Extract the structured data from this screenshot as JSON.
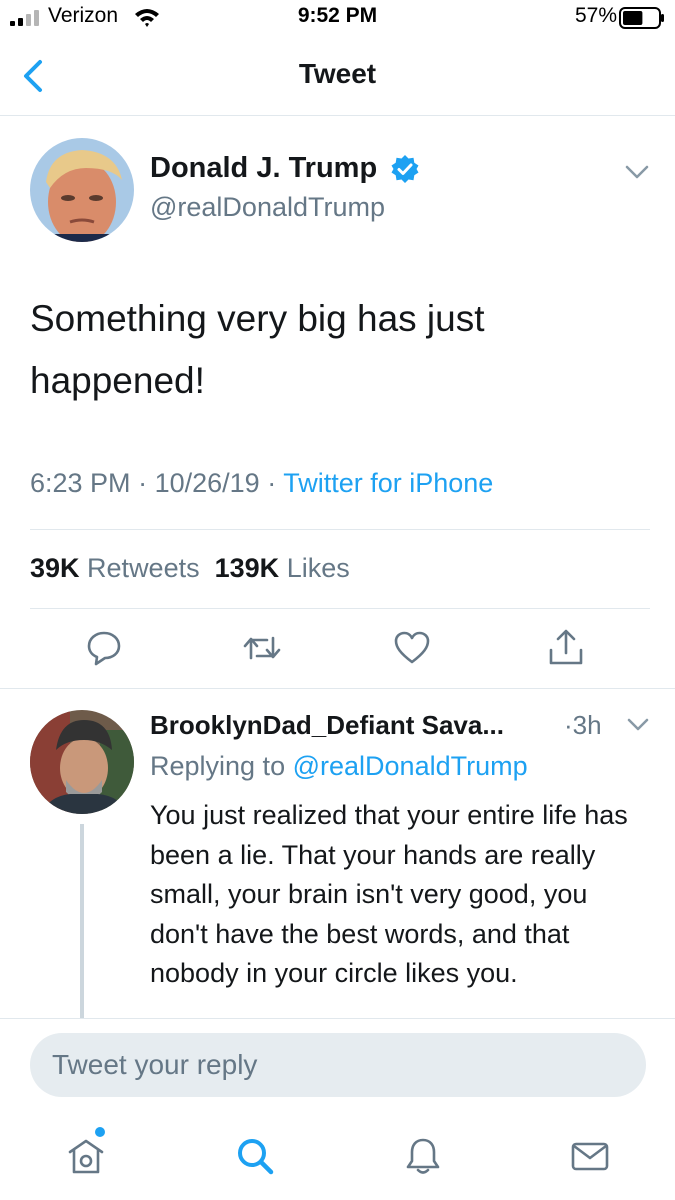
{
  "status_bar": {
    "carrier": "Verizon",
    "time": "9:52 PM",
    "battery_percent": "57%",
    "battery_level": 0.57
  },
  "nav": {
    "title": "Tweet",
    "back_icon": "chevron-left-icon"
  },
  "tweet": {
    "author_name": "Donald J. Trump",
    "handle": "@realDonaldTrump",
    "verified": true,
    "text": "Something very big has just happened!",
    "time": "6:23 PM",
    "date": "10/26/19",
    "separator": "·",
    "source": "Twitter for iPhone",
    "retweet_count": "39K",
    "retweet_label": "Retweets",
    "like_count": "139K",
    "like_label": "Likes",
    "actions": [
      "reply-icon",
      "retweet-icon",
      "like-icon",
      "share-icon"
    ]
  },
  "reply": {
    "author_name": "BrooklynDad_Defiant Sava...",
    "time": "·3h",
    "replying_prefix": "Replying to",
    "replying_to": "@realDonaldTrump",
    "text": "You just realized that your entire life has been a lie. That your hands are really small, your brain isn't very good, you don't have the best words, and that nobody in your circle likes you."
  },
  "composer": {
    "placeholder": "Tweet your reply"
  },
  "tab_bar": {
    "items": [
      "home-icon",
      "search-icon",
      "notifications-icon",
      "messages-icon"
    ],
    "home_has_notification": true
  },
  "colors": {
    "accent": "#1da1f2",
    "text_primary": "#14171a",
    "text_secondary": "#657786",
    "divider": "#e1e8ed",
    "composer_bg": "#e6ecf0"
  }
}
